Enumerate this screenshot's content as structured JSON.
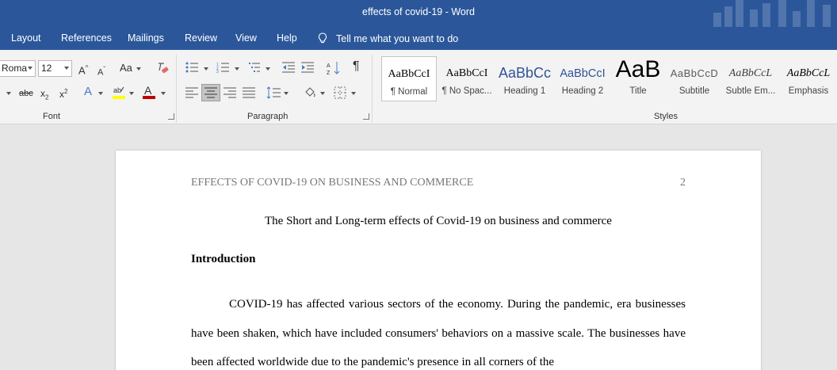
{
  "window": {
    "title": "effects of covid-19  -  Word"
  },
  "tabs": [
    "Layout",
    "References",
    "Mailings",
    "Review",
    "View",
    "Help"
  ],
  "tell_me": "Tell me what you want to do",
  "font": {
    "name": "Roma",
    "size": "12"
  },
  "groups": {
    "font": "Font",
    "paragraph": "Paragraph",
    "styles": "Styles"
  },
  "styles": [
    {
      "sample": "AaBbCcI",
      "label": "¶ Normal"
    },
    {
      "sample": "AaBbCcI",
      "label": "¶ No Spac..."
    },
    {
      "sample": "AaBbCc",
      "label": "Heading 1"
    },
    {
      "sample": "AaBbCcI",
      "label": "Heading 2"
    },
    {
      "sample": "AaB",
      "label": "Title"
    },
    {
      "sample": "AaBbCcD",
      "label": "Subtitle"
    },
    {
      "sample": "AaBbCcL",
      "label": "Subtle Em..."
    },
    {
      "sample": "AaBbCcL",
      "label": "Emphasis"
    }
  ],
  "colors": {
    "title_bar": "#2b579a",
    "highlight": "#ffff00",
    "font_color": "#c00000"
  },
  "document": {
    "running_head": "EFFECTS OF COVID-19 ON BUSINESS AND COMMERCE",
    "page_number": "2",
    "title": "The Short and Long-term effects of Covid-19 on business and commerce",
    "heading": "Introduction",
    "paragraph": "COVID-19 has affected various sectors of the economy. During the pandemic, era businesses have been shaken, which have included consumers' behaviors on a massive scale. The businesses have been affected worldwide due to the pandemic's presence in all corners of the"
  }
}
